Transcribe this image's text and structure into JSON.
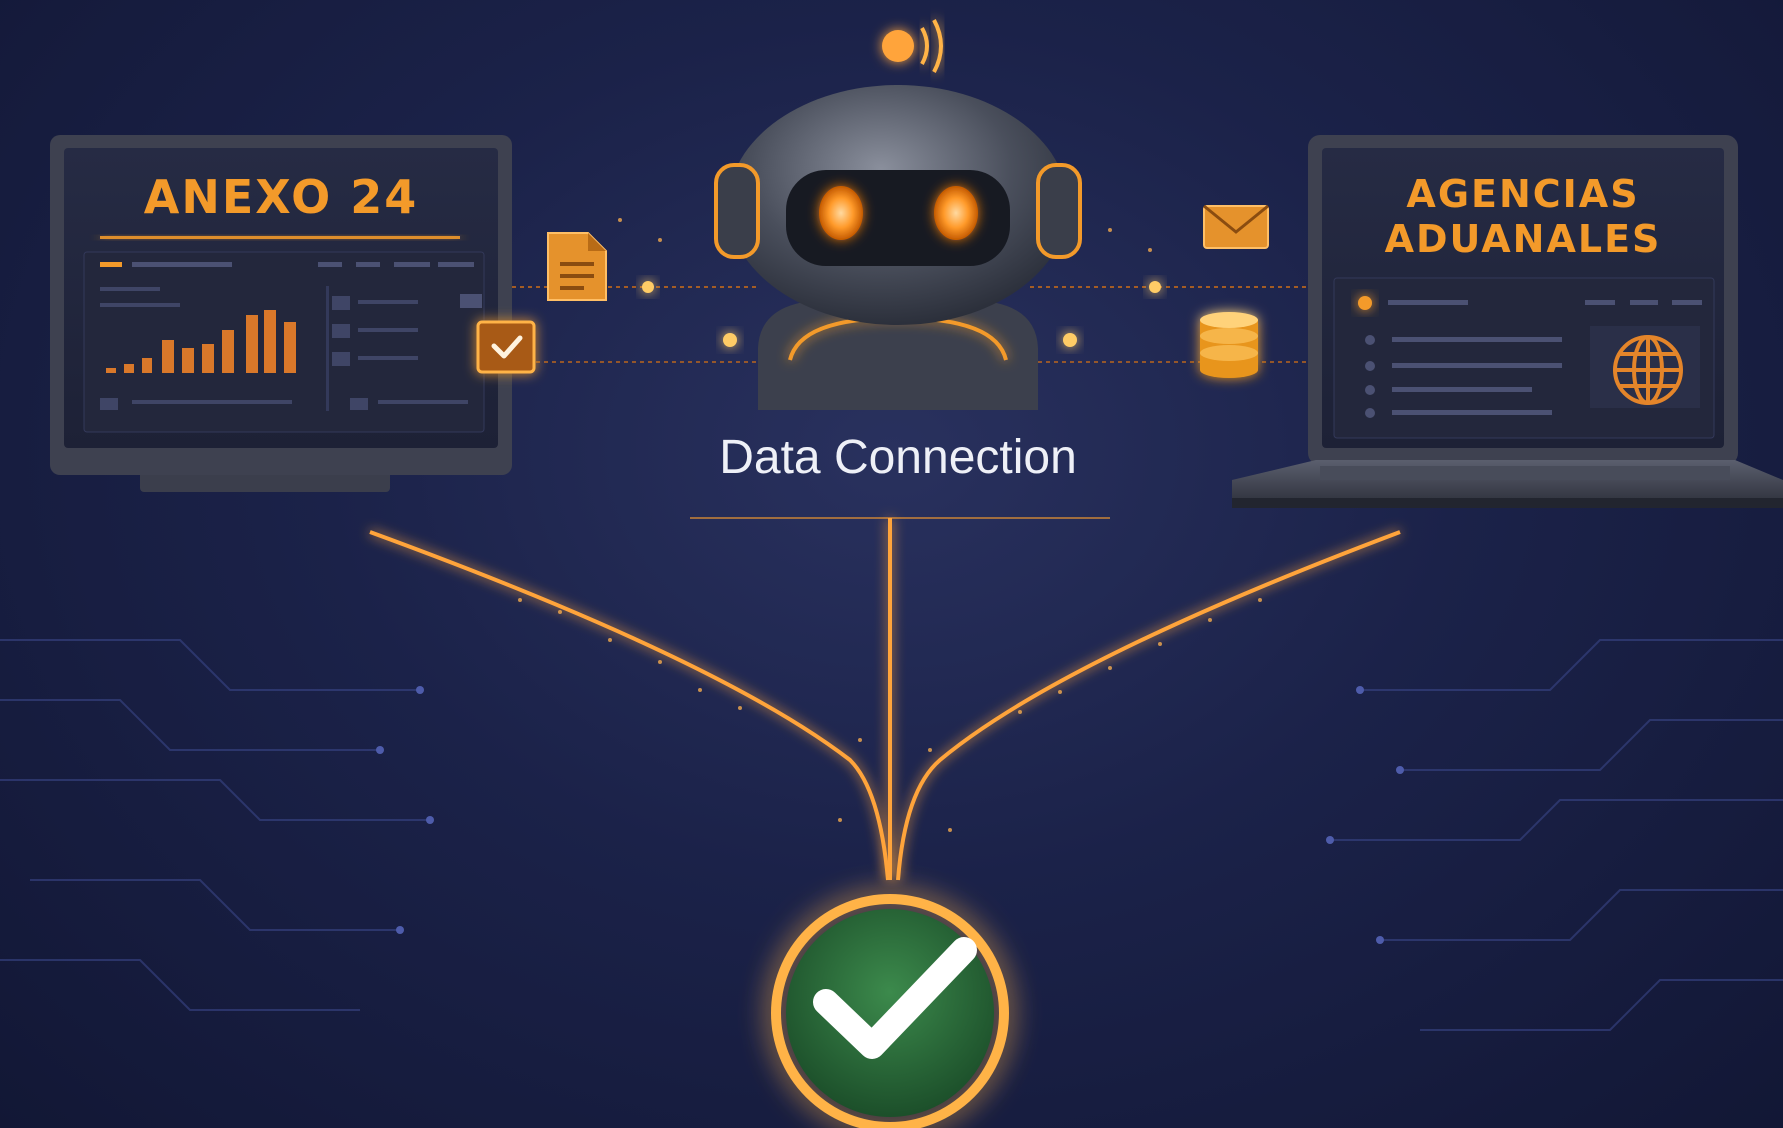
{
  "diagram": {
    "left_system_title": "ANEXO 24",
    "right_system_title_line1": "AGENCIAS",
    "right_system_title_line2": "ADUANALES",
    "center_caption": "Data Connection"
  },
  "icons": {
    "robot": "robot-icon",
    "document": "document-icon",
    "checkbox": "checkbox-icon",
    "envelope": "envelope-icon",
    "database": "database-icon",
    "globe": "globe-icon",
    "success": "checkmark-icon"
  },
  "colors": {
    "background": "#1b2249",
    "accent_orange": "#f39a2a",
    "glow_orange": "#ffb347",
    "success_green": "#2f7a3f",
    "caption_white": "#eef0f7"
  }
}
